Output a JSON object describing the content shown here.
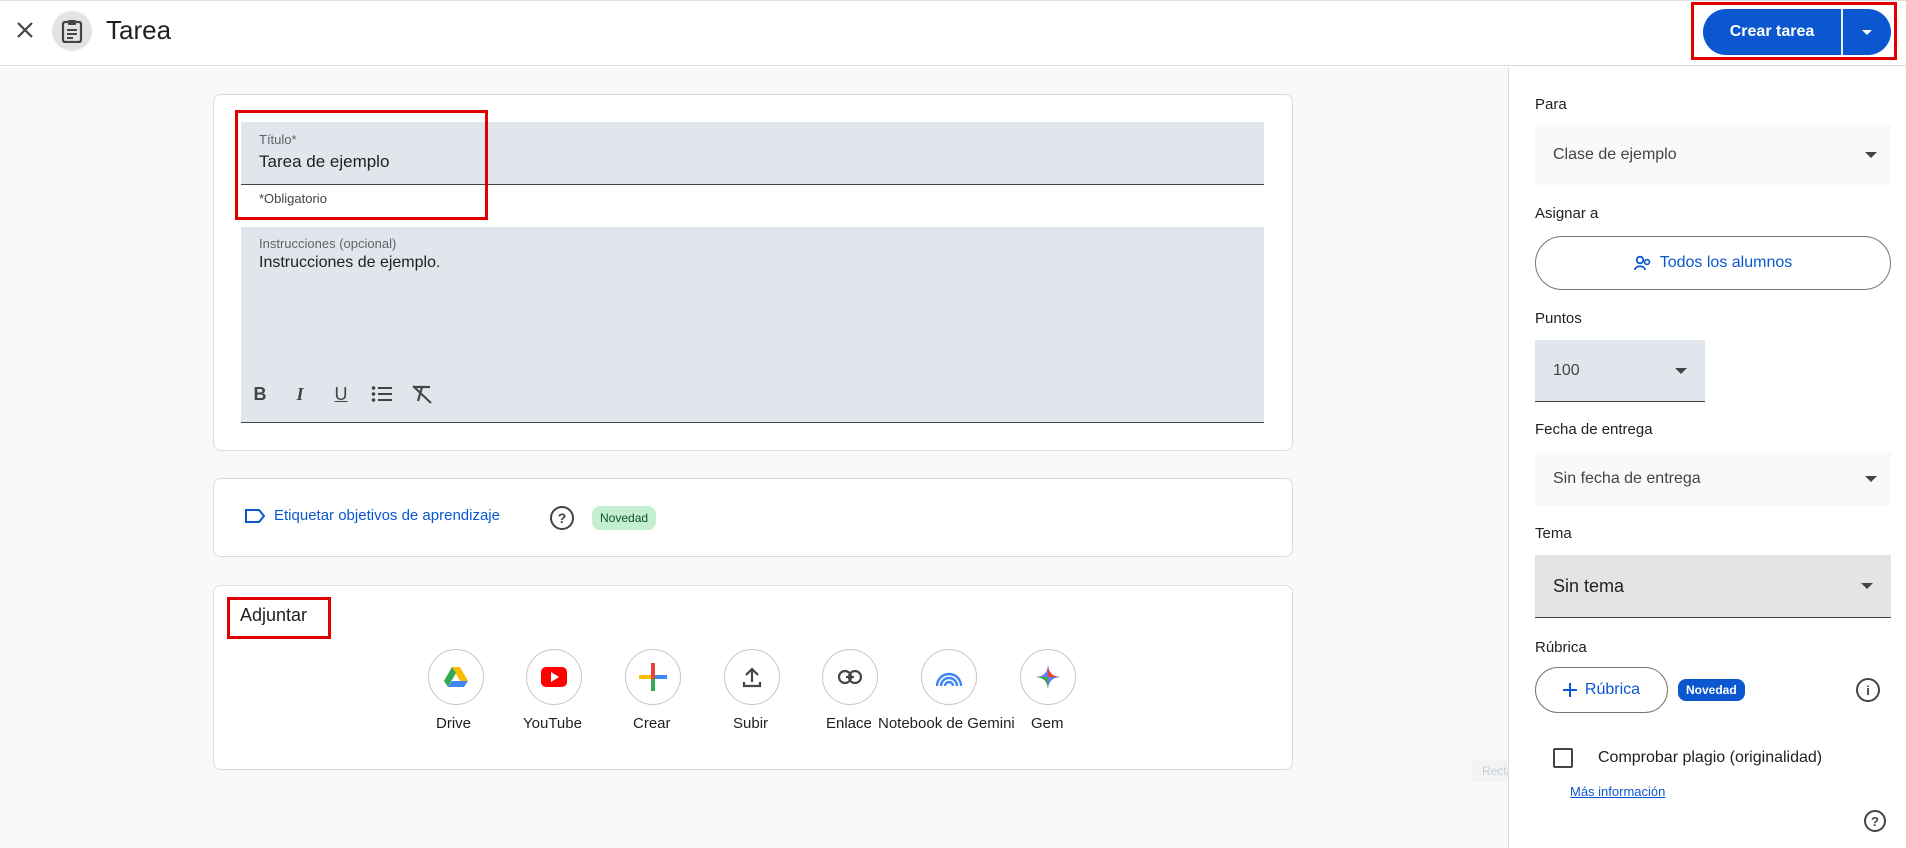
{
  "header": {
    "title": "Tarea",
    "create_label": "Crear tarea"
  },
  "form": {
    "title_label": "Título*",
    "title_value": "Tarea de ejemplo",
    "required_hint": "*Obligatorio",
    "instructions_label": "Instrucciones (opcional)",
    "instructions_value": "Instrucciones de ejemplo."
  },
  "objectives": {
    "link_label": "Etiquetar objetivos de aprendizaje",
    "badge": "Novedad"
  },
  "attach": {
    "title": "Adjuntar",
    "items": [
      {
        "label": "Drive",
        "icon": "drive-icon"
      },
      {
        "label": "YouTube",
        "icon": "youtube-icon"
      },
      {
        "label": "Crear",
        "icon": "plus-icon"
      },
      {
        "label": "Subir",
        "icon": "upload-icon"
      },
      {
        "label": "Enlace",
        "icon": "link-icon"
      },
      {
        "label": "Notebook de Gemini",
        "icon": "notebook-icon"
      },
      {
        "label": "Gem",
        "icon": "gem-icon"
      }
    ]
  },
  "sidebar": {
    "for_label": "Para",
    "for_value": "Clase de ejemplo",
    "assign_label": "Asignar a",
    "assign_value": "Todos los alumnos",
    "points_label": "Puntos",
    "points_value": "100",
    "due_label": "Fecha de entrega",
    "due_value": "Sin fecha de entrega",
    "topic_label": "Tema",
    "topic_value": "Sin tema",
    "rubric_label": "Rúbrica",
    "rubric_button": "Rúbrica",
    "rubric_badge": "Novedad",
    "plagiarism_label": "Comprobar plagio (originalidad)",
    "more_info": "Más información"
  },
  "overlay": {
    "ghost_label": "Rectangle"
  },
  "colors": {
    "primary": "#0b57d0",
    "highlight": "#e00000",
    "badge_green": "#c4eed0"
  }
}
